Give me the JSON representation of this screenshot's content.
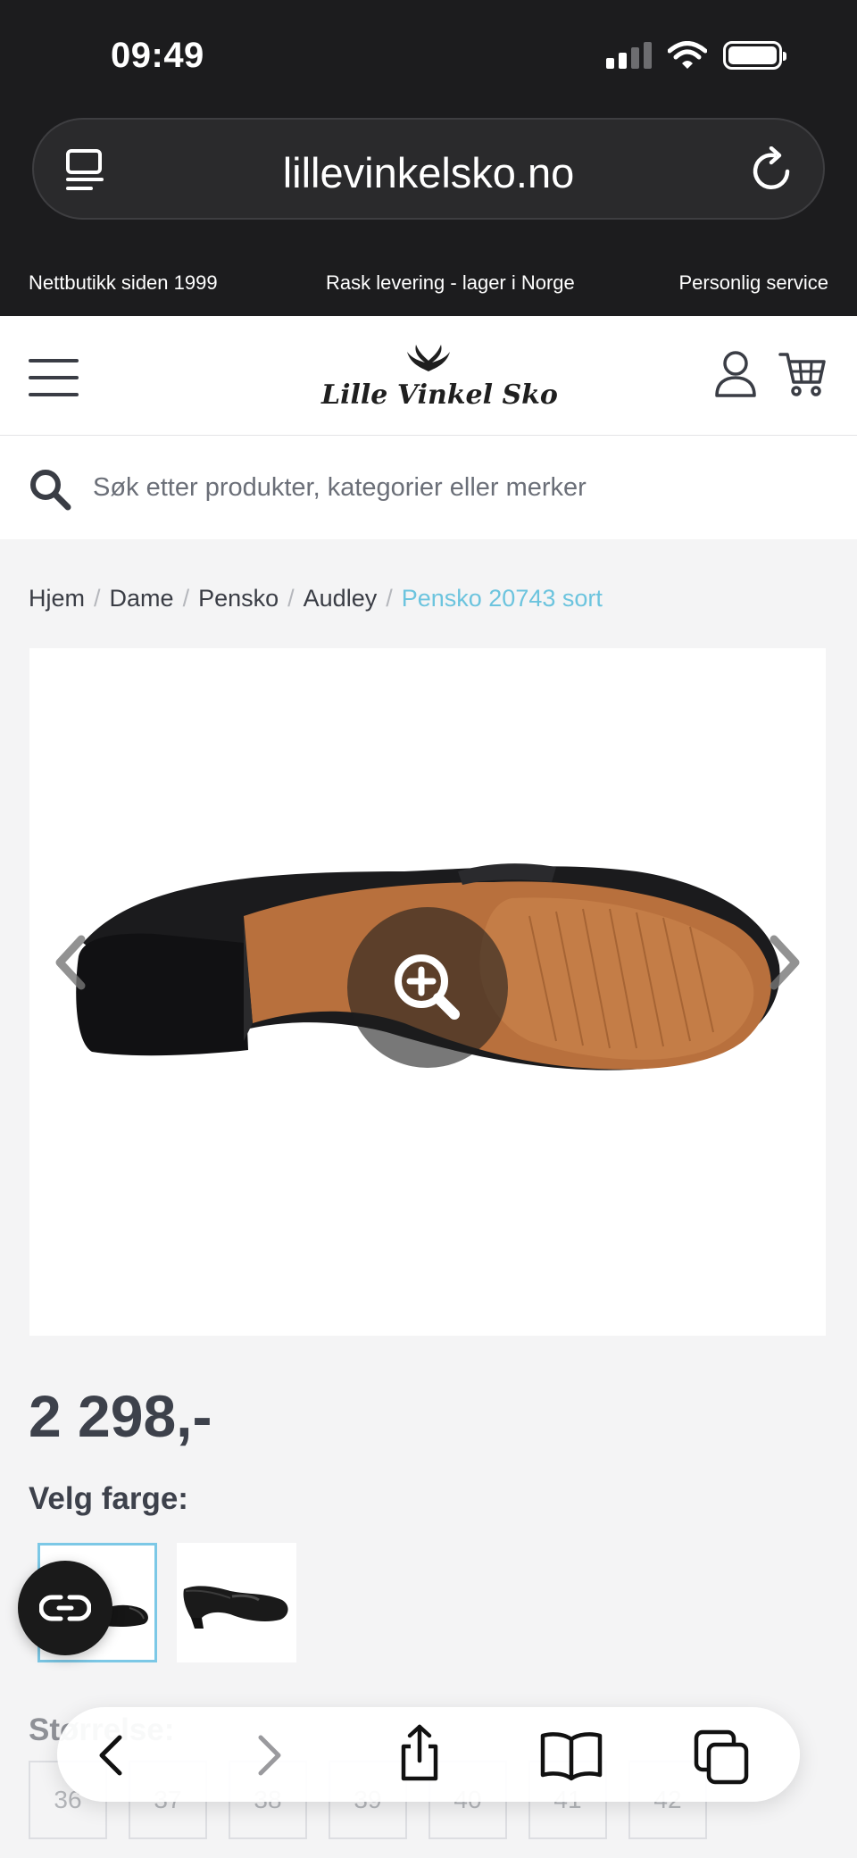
{
  "status_bar": {
    "time": "09:49"
  },
  "browser": {
    "url": "lillevinkelsko.no"
  },
  "info_strip": [
    "Nettbutikk siden 1999",
    "Rask levering - lager i Norge",
    "Personlig service"
  ],
  "header": {
    "logo_text": "Lille Vinkel Sko"
  },
  "search": {
    "placeholder": "Søk etter produkter, kategorier eller merker"
  },
  "breadcrumb": [
    "Hjem",
    "Dame",
    "Pensko",
    "Audley",
    "Pensko 20743 sort"
  ],
  "product": {
    "price": "2 298,-",
    "color_label": "Velg farge:",
    "size_label": "Størrelse:",
    "sizes": [
      "36",
      "37",
      "38",
      "39",
      "40",
      "41",
      "42"
    ]
  },
  "colors": {
    "accent": "#6cc4de",
    "chrome": "#1c1c1e",
    "text": "#3d414b"
  }
}
